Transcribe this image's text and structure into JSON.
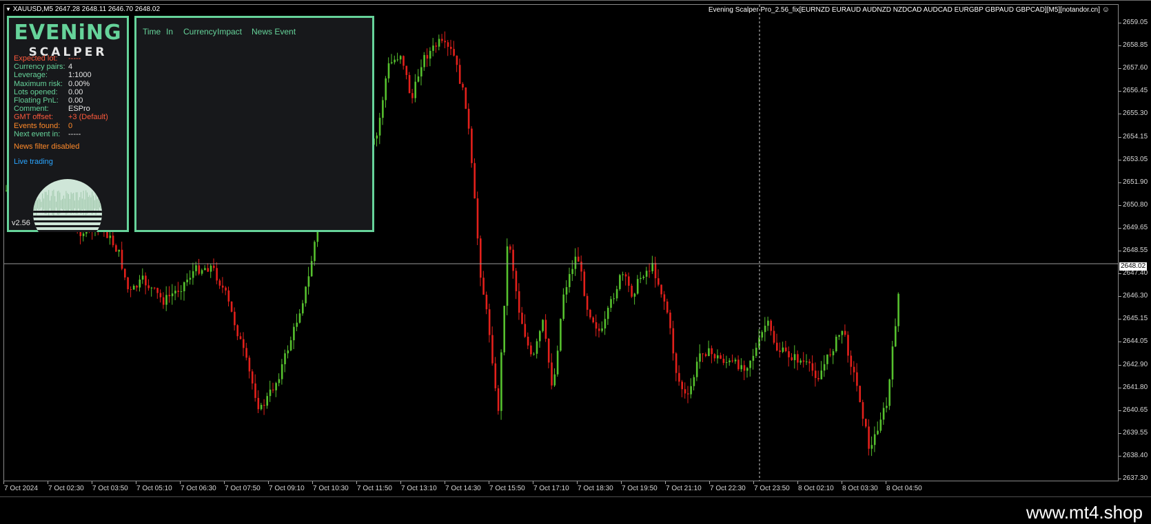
{
  "chart": {
    "symbol_header": "XAUUSD,M5  2647.28 2648.11 2646.70 2648.02",
    "ea_title": "Evening Scalper Pro_2.56_fix[EURNZD EURAUD AUDNZD NZDCAD AUDCAD EURGBP GBPAUD GBPCAD][M5][notandor.cn]",
    "current_price": "2648.02",
    "colors": {
      "bull": "#56c12e",
      "bear": "#e3201b",
      "background": "#000000",
      "accent": "#66d39a"
    }
  },
  "info_panel": {
    "logo_top": "EVENiNG",
    "logo_bottom": "SCALPER",
    "rows": [
      {
        "label": "Expected lot:",
        "value": "-----",
        "color": "red"
      },
      {
        "label": "Currency pairs:",
        "value": "4",
        "color": "green"
      },
      {
        "label": "Leverage:",
        "value": "1:1000",
        "color": "green"
      },
      {
        "label": "Maximum risk:",
        "value": "0.00%",
        "color": "green"
      },
      {
        "label": "Lots opened:",
        "value": "0.00",
        "color": "green"
      },
      {
        "label": "Floating PnL:",
        "value": "0.00",
        "color": "green"
      },
      {
        "label": "Comment:",
        "value": "ESPro",
        "color": "green"
      },
      {
        "label": "GMT offset:",
        "value": "+3 (Default)",
        "color": "red"
      },
      {
        "label": "Events found:",
        "value": "0",
        "color": "orange"
      },
      {
        "label": "Next event in:",
        "value": "-----",
        "color": "green"
      }
    ],
    "news_filter_status": "News filter disabled",
    "trading_mode": "Live trading",
    "version": "v2.56"
  },
  "news_panel": {
    "columns": [
      "Time",
      "In",
      "Currency",
      "Impact",
      "News Event"
    ]
  },
  "price_axis": {
    "labels": [
      "2659.05",
      "2658.85",
      "2657.60",
      "2656.45",
      "2655.30",
      "2654.15",
      "2653.05",
      "2651.90",
      "2650.80",
      "2649.65",
      "2648.55",
      "2647.40",
      "2646.30",
      "2645.15",
      "2644.05",
      "2642.90",
      "2641.80",
      "2640.65",
      "2639.55",
      "2638.40",
      "2637.30"
    ]
  },
  "time_axis": {
    "labels": [
      "7 Oct 2024",
      "7 Oct 02:30",
      "7 Oct 03:50",
      "7 Oct 05:10",
      "7 Oct 06:30",
      "7 Oct 07:50",
      "7 Oct 09:10",
      "7 Oct 10:30",
      "7 Oct 11:50",
      "7 Oct 13:10",
      "7 Oct 14:30",
      "7 Oct 15:50",
      "7 Oct 17:10",
      "7 Oct 18:30",
      "7 Oct 19:50",
      "7 Oct 21:10",
      "7 Oct 22:30",
      "7 Oct 23:50",
      "8 Oct 02:10",
      "8 Oct 03:30",
      "8 Oct 04:50"
    ]
  },
  "watermark": "www.mt4.shop"
}
